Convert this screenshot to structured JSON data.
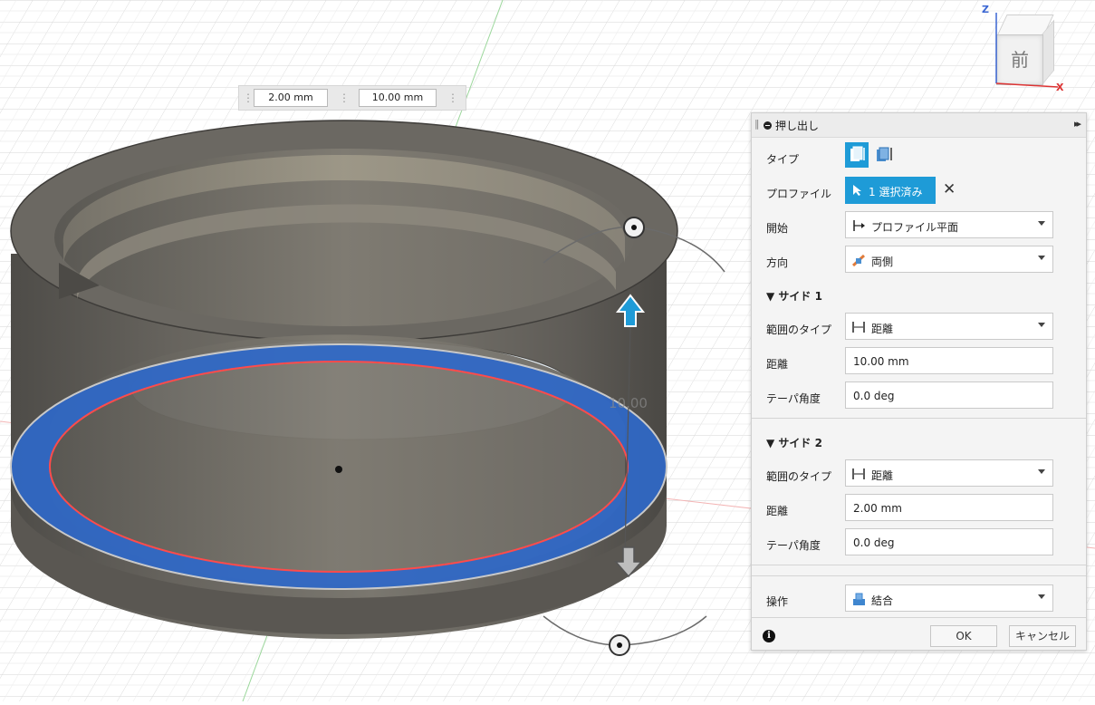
{
  "viewport": {
    "mini_toolbar": {
      "field1": "2.00 mm",
      "field2": "10.00 mm"
    },
    "dimension_label": "10.00",
    "viewcube": {
      "face_label": "前",
      "z_axis": "Z",
      "x_axis": "X"
    }
  },
  "dialog": {
    "title": "押し出し",
    "rows": {
      "type_label": "タイプ",
      "profile_label": "プロファイル",
      "profile_button": "1 選択済み",
      "start_label": "開始",
      "start_value": "プロファイル平面",
      "direction_label": "方向",
      "direction_value": "両側"
    },
    "side1": {
      "header": "サイド 1",
      "extent_label": "範囲のタイプ",
      "extent_value": "距離",
      "distance_label": "距離",
      "distance_value": "10.00 mm",
      "taper_label": "テーパ角度",
      "taper_value": "0.0 deg"
    },
    "side2": {
      "header": "サイド 2",
      "extent_label": "範囲のタイプ",
      "extent_value": "距離",
      "distance_label": "距離",
      "distance_value": "2.00 mm",
      "taper_label": "テーパ角度",
      "taper_value": "0.0 deg"
    },
    "operation_label": "操作",
    "operation_value": "結合",
    "ok_button": "OK",
    "cancel_button": "キャンセル",
    "colors": {
      "accent": "#1e9bd7",
      "selection_blue": "#2f68c8",
      "body_gray": "#6d6a64"
    }
  }
}
